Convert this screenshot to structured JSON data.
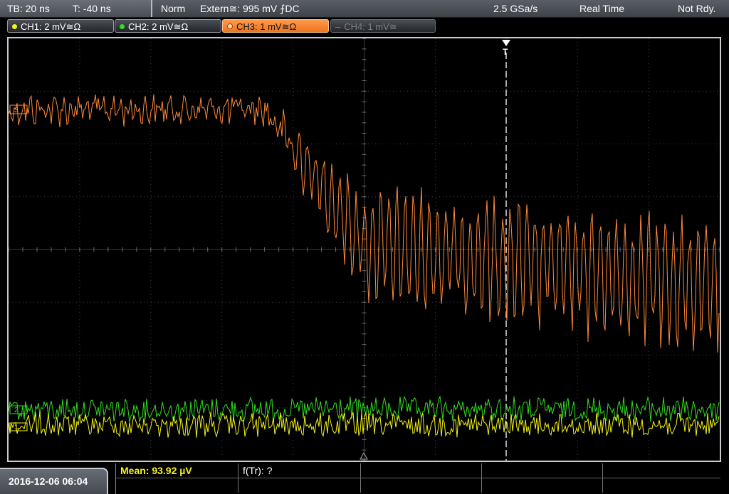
{
  "topbar": {
    "timebase": "TB: 20 ns",
    "trigger_pos": "T: -40 ns",
    "mode": "Norm",
    "trigger_source": "Extern≅: 995 mV ⨍DC",
    "sample_rate": "2.5 GSa/s",
    "acq_mode": "Real Time",
    "status": "Not Rdy."
  },
  "channels": [
    {
      "label": "CH1: 2 mV≅Ω",
      "color": "#f5f514",
      "state": "on"
    },
    {
      "label": "CH2: 2 mV≅Ω",
      "color": "#33dd22",
      "state": "on"
    },
    {
      "label": "CH3: 1 mV≅Ω",
      "color": "#ff8a3a",
      "state": "selected"
    },
    {
      "label": "CH4: 1 mV≅",
      "color": "#7c7f85",
      "state": "off"
    }
  ],
  "markers": {
    "ch3": "3",
    "ch2": "2",
    "ch1": "1",
    "trigger": "T"
  },
  "bottombar": {
    "datetime": "2016-12-06 06:04",
    "mean": "Mean: 93.92 µV",
    "rise": "f(Tr): ?"
  },
  "colors": {
    "ch1": "#f5f514",
    "ch2": "#33dd22",
    "ch3": "#ff8a3a",
    "grid": "#3a3d42"
  }
}
